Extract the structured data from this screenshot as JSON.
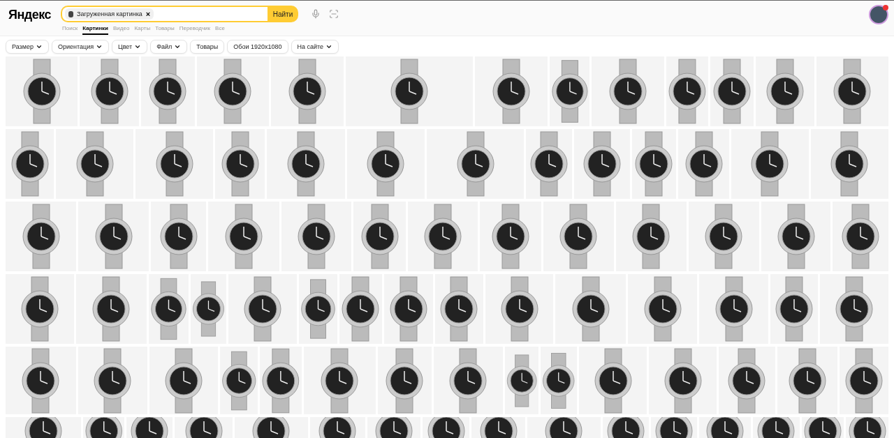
{
  "logo": "Яндекс",
  "search": {
    "chip": "Загруженная картинка",
    "chip_close": "×",
    "button": "Найти"
  },
  "tabs": [
    {
      "label": "Поиск",
      "selected": false
    },
    {
      "label": "Картинки",
      "selected": true
    },
    {
      "label": "Видео",
      "selected": false
    },
    {
      "label": "Карты",
      "selected": false
    },
    {
      "label": "Товары",
      "selected": false
    },
    {
      "label": "Переводчик",
      "selected": false
    },
    {
      "label": "Все",
      "selected": false
    }
  ],
  "filters": [
    {
      "label": "Размер",
      "kind": "dropdown"
    },
    {
      "label": "Ориентация",
      "kind": "dropdown"
    },
    {
      "label": "Цвет",
      "kind": "dropdown"
    },
    {
      "label": "Файл",
      "kind": "dropdown"
    },
    {
      "label": "Товары",
      "kind": "plain"
    },
    {
      "label": "Обои 1920x1080",
      "kind": "plain"
    },
    {
      "label": "На сайте",
      "kind": "dropdown"
    }
  ],
  "profile": {
    "notification": true
  }
}
